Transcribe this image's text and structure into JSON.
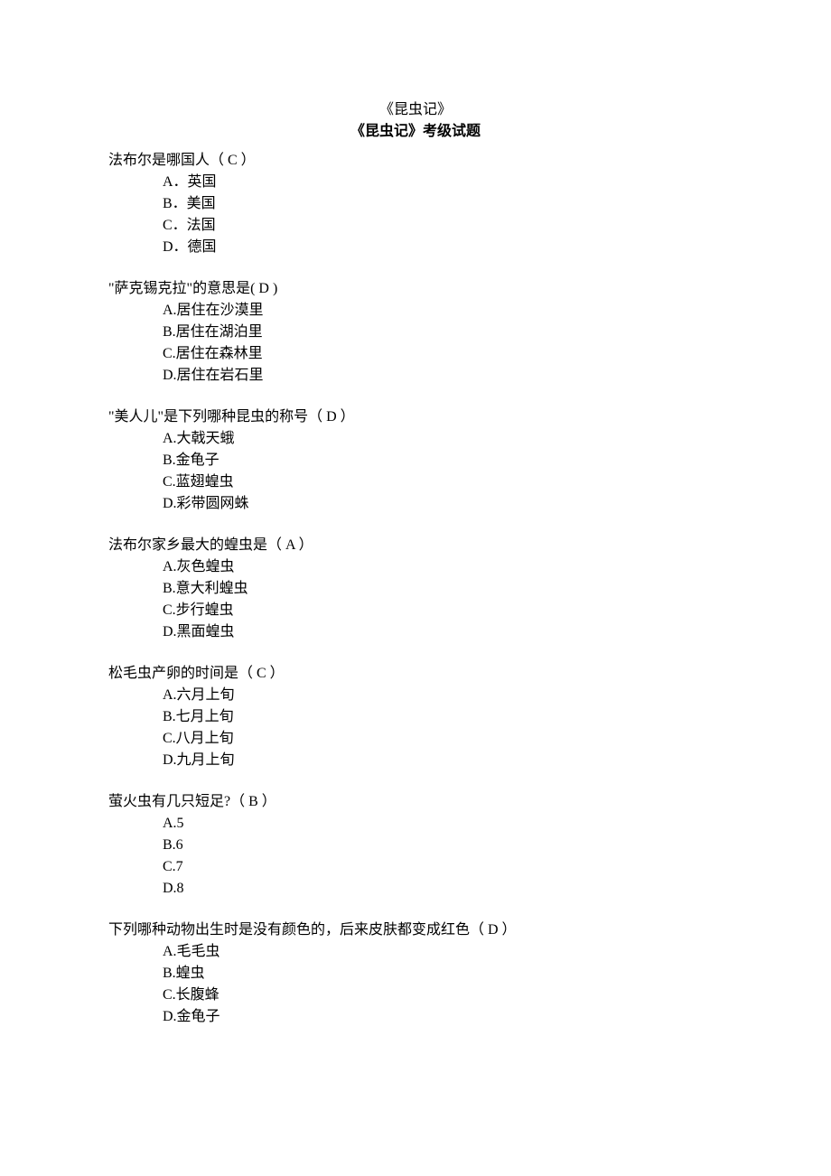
{
  "title": "《昆虫记》",
  "subtitle": "《昆虫记》考级试题",
  "questions": [
    {
      "text": "法布尔是哪国人（ C ）",
      "options": [
        "A．英国",
        "B．美国",
        "C．法国",
        "D．德国"
      ]
    },
    {
      "text": "\"萨克锡克拉\"的意思是(   D   )",
      "options": [
        "A.居住在沙漠里",
        "B.居住在湖泊里",
        "C.居住在森林里",
        "D.居住在岩石里"
      ]
    },
    {
      "text": "\"美人儿\"是下列哪种昆虫的称号（  D  ）",
      "options": [
        "A.大戟天蛾",
        "B.金龟子",
        "C.蓝翅蝗虫",
        "D.彩带圆网蛛"
      ]
    },
    {
      "text": "法布尔家乡最大的蝗虫是（  A  ）",
      "options": [
        "A.灰色蝗虫",
        "B.意大利蝗虫",
        "C.步行蝗虫",
        "D.黑面蝗虫"
      ]
    },
    {
      "text": "松毛虫产卵的时间是（  C  ）",
      "options": [
        "A.六月上旬",
        "B.七月上旬",
        "C.八月上旬",
        "D.九月上旬"
      ]
    },
    {
      "text": "萤火虫有几只短足?（  B  ）",
      "options": [
        "A.5",
        "B.6",
        "C.7",
        "D.8"
      ]
    },
    {
      "text": "下列哪种动物出生时是没有颜色的，后来皮肤都变成红色（  D  ）",
      "options": [
        "A.毛毛虫",
        "B.蝗虫",
        "C.长腹蜂",
        "D.金龟子"
      ]
    }
  ]
}
